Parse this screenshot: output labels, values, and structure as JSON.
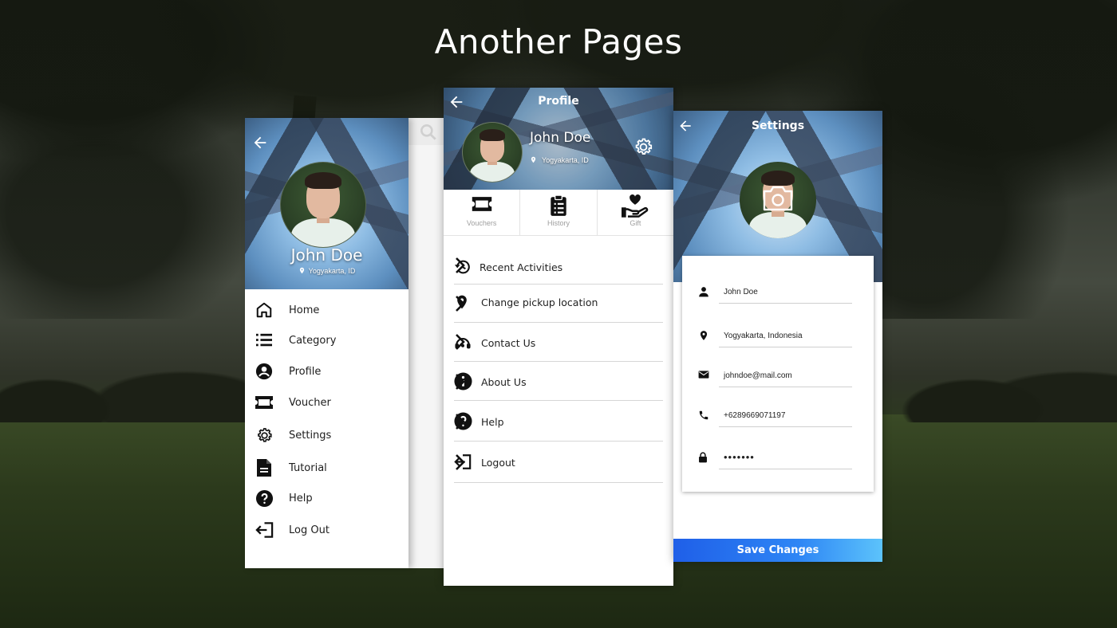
{
  "heading": "Another Pages",
  "drawer": {
    "user_name": "John Doe",
    "location": "Yogyakarta, ID",
    "menu": [
      {
        "label": "Home",
        "icon": "home-icon"
      },
      {
        "label": "Category",
        "icon": "list-icon"
      },
      {
        "label": "Profile",
        "icon": "account-icon"
      },
      {
        "label": "Voucher",
        "icon": "ticket-icon"
      },
      {
        "label": "Settings",
        "icon": "gear-icon"
      },
      {
        "label": "Tutorial",
        "icon": "document-icon"
      },
      {
        "label": "Help",
        "icon": "help-icon"
      },
      {
        "label": "Log Out",
        "icon": "logout-icon"
      }
    ]
  },
  "profile": {
    "title": "Profile",
    "user_name": "John Doe",
    "location": "Yogyakarta, ID",
    "tabs": [
      {
        "label": "Vouchers",
        "icon": "ticket-icon"
      },
      {
        "label": "History",
        "icon": "clipboard-icon"
      },
      {
        "label": "Gift",
        "icon": "hand-heart-icon"
      }
    ],
    "items": [
      {
        "label": "Recent Activities",
        "icon": "history-icon"
      },
      {
        "label": "Change pickup location",
        "icon": "map-pin-icon"
      },
      {
        "label": "Contact Us",
        "icon": "headset-icon"
      },
      {
        "label": "About Us",
        "icon": "info-icon"
      },
      {
        "label": "Help",
        "icon": "help-icon"
      },
      {
        "label": "Logout",
        "icon": "logout-icon"
      }
    ]
  },
  "settings": {
    "title": "Settings",
    "fields": [
      {
        "value": "John Doe",
        "icon": "person-icon"
      },
      {
        "value": "Yogyakarta, Indonesia",
        "icon": "map-pin-icon"
      },
      {
        "value": "johndoe@mail.com",
        "icon": "mail-icon"
      },
      {
        "value": "+6289669071197",
        "icon": "phone-icon"
      },
      {
        "value": "•••••••",
        "icon": "lock-icon"
      }
    ],
    "save_label": "Save Changes"
  },
  "colors": {
    "save_button_start": "#1f5fe8",
    "save_button_end": "#5cc3fb",
    "text_dark": "#1f1f1f",
    "tab_label": "#9e9e9e"
  }
}
